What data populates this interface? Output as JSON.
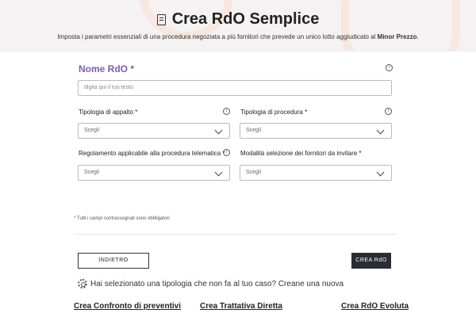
{
  "header": {
    "title": "Crea RdO Semplice",
    "subtitle_main": "Imposta i parametri essenziali di una procedura negoziata a più fornitori che prevede un unico lotto aggiudicato al ",
    "subtitle_bold": "Minor Prezzo",
    "subtitle_end": ".",
    "title_icon": "document-icon"
  },
  "form": {
    "nome_label": "Nome RdO *",
    "nome_placeholder": "digita qui il tuo testo",
    "fields": [
      {
        "label": "Tipologia di appalto *",
        "value": "Scegli"
      },
      {
        "label": "Tipologia di procedura *",
        "value": "Scegli"
      },
      {
        "label": "Regolamento applicabile alla procedura telematica *",
        "value": "Scegli"
      },
      {
        "label": "Modalità selezione dei fornitori da invitare *",
        "value": "Scegli"
      }
    ],
    "info_glyph": "i",
    "required_note": "* Tutti i campi contrassegnati sono obbligatori"
  },
  "actions": {
    "back_label": "INDIETRO",
    "create_label": "CREA RdO"
  },
  "hint": {
    "text": "Hai selezionato una tipologia che non fa al tuo caso? Creane una nuova",
    "icon": "gear-icon"
  },
  "links": [
    "Crea Confronto di preventivi",
    "Crea Trattativa Diretta",
    "Crea RdO Evoluta"
  ],
  "colors": {
    "label_accent": "#7b5ea7",
    "primary_button": "#2b2b33",
    "header_bg": "#f4f2f2"
  }
}
